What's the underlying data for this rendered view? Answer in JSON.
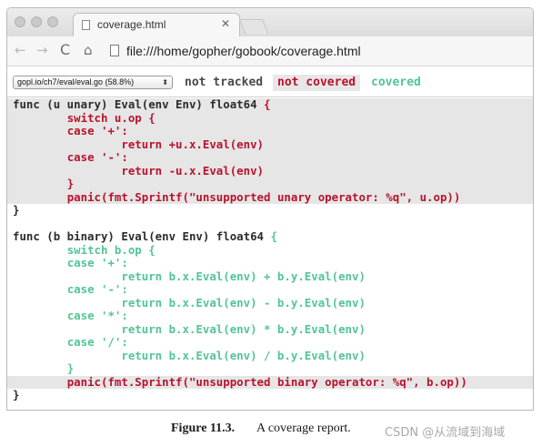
{
  "tab": {
    "title": "coverage.html",
    "close": "✕"
  },
  "toolbar": {
    "back": "←",
    "forward": "→",
    "reload": "C",
    "home": "⌂",
    "url": "file:///home/gopher/gobook/coverage.html"
  },
  "coverage": {
    "file_select": "gopl.io/ch7/eval/eval.go (58.8%)",
    "legend": {
      "not_tracked": "not tracked",
      "not_covered": "not covered",
      "covered": "covered"
    },
    "colors": {
      "not_tracked": "#4a4a4a",
      "not_covered": "#b8132d",
      "covered": "#52c593",
      "not_covered_bg": "#e6e6e6"
    }
  },
  "code_lines": [
    {
      "hl": true,
      "segs": [
        {
          "c": "t",
          "s": "func (u unary) Eval(env Env) float64 "
        },
        {
          "c": "r",
          "s": "{"
        }
      ]
    },
    {
      "hl": true,
      "segs": [
        {
          "c": "t",
          "s": "        "
        },
        {
          "c": "r",
          "s": "switch u.op {"
        }
      ]
    },
    {
      "hl": true,
      "segs": [
        {
          "c": "t",
          "s": "        "
        },
        {
          "c": "r",
          "s": "case '+':"
        }
      ]
    },
    {
      "hl": true,
      "segs": [
        {
          "c": "t",
          "s": "                "
        },
        {
          "c": "r",
          "s": "return +u.x.Eval(env)"
        }
      ]
    },
    {
      "hl": true,
      "segs": [
        {
          "c": "t",
          "s": "        "
        },
        {
          "c": "r",
          "s": "case '-':"
        }
      ]
    },
    {
      "hl": true,
      "segs": [
        {
          "c": "t",
          "s": "                "
        },
        {
          "c": "r",
          "s": "return -u.x.Eval(env)"
        }
      ]
    },
    {
      "hl": true,
      "segs": [
        {
          "c": "t",
          "s": "        "
        },
        {
          "c": "r",
          "s": "}"
        }
      ]
    },
    {
      "hl": true,
      "segs": [
        {
          "c": "t",
          "s": "        "
        },
        {
          "c": "r",
          "s": "panic(fmt.Sprintf(\"unsupported unary operator: %q\", u.op))"
        }
      ]
    },
    {
      "hl": false,
      "segs": [
        {
          "c": "t",
          "s": "}"
        }
      ]
    },
    {
      "hl": false,
      "segs": [
        {
          "c": "t",
          "s": ""
        }
      ]
    },
    {
      "hl": false,
      "segs": [
        {
          "c": "t",
          "s": "func (b binary) Eval(env Env) float64 "
        },
        {
          "c": "g",
          "s": "{"
        }
      ]
    },
    {
      "hl": false,
      "segs": [
        {
          "c": "t",
          "s": "        "
        },
        {
          "c": "g",
          "s": "switch b.op {"
        }
      ]
    },
    {
      "hl": false,
      "segs": [
        {
          "c": "t",
          "s": "        "
        },
        {
          "c": "g",
          "s": "case '+':"
        }
      ]
    },
    {
      "hl": false,
      "segs": [
        {
          "c": "t",
          "s": "                "
        },
        {
          "c": "g",
          "s": "return b.x.Eval(env) + b.y.Eval(env)"
        }
      ]
    },
    {
      "hl": false,
      "segs": [
        {
          "c": "t",
          "s": "        "
        },
        {
          "c": "g",
          "s": "case '-':"
        }
      ]
    },
    {
      "hl": false,
      "segs": [
        {
          "c": "t",
          "s": "                "
        },
        {
          "c": "g",
          "s": "return b.x.Eval(env) - b.y.Eval(env)"
        }
      ]
    },
    {
      "hl": false,
      "segs": [
        {
          "c": "t",
          "s": "        "
        },
        {
          "c": "g",
          "s": "case '*':"
        }
      ]
    },
    {
      "hl": false,
      "segs": [
        {
          "c": "t",
          "s": "                "
        },
        {
          "c": "g",
          "s": "return b.x.Eval(env) * b.y.Eval(env)"
        }
      ]
    },
    {
      "hl": false,
      "segs": [
        {
          "c": "t",
          "s": "        "
        },
        {
          "c": "g",
          "s": "case '/':"
        }
      ]
    },
    {
      "hl": false,
      "segs": [
        {
          "c": "t",
          "s": "                "
        },
        {
          "c": "g",
          "s": "return b.x.Eval(env) / b.y.Eval(env)"
        }
      ]
    },
    {
      "hl": false,
      "segs": [
        {
          "c": "t",
          "s": "        "
        },
        {
          "c": "g",
          "s": "}"
        }
      ]
    },
    {
      "hl": true,
      "segs": [
        {
          "c": "t",
          "s": "        "
        },
        {
          "c": "r",
          "s": "panic(fmt.Sprintf(\"unsupported binary operator: %q\", b.op))"
        }
      ]
    },
    {
      "hl": false,
      "segs": [
        {
          "c": "t",
          "s": "}"
        }
      ]
    }
  ],
  "caption": {
    "label": "Figure 11.3.",
    "text": "A coverage report.",
    "watermark": "CSDN @从流域到海域"
  }
}
